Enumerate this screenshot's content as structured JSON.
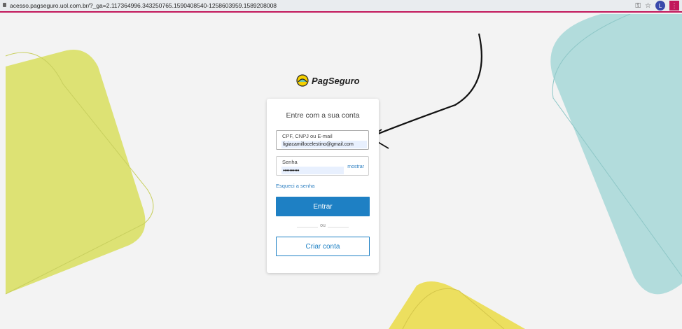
{
  "browser": {
    "url": "acesso.pagseguro.uol.com.br/?_ga=2.117364996.343250765.1590408540-1258603959.1589208008",
    "avatar_letter": "L"
  },
  "logo": {
    "text": "PagSeguro"
  },
  "login": {
    "title": "Entre com a sua conta",
    "email_label": "CPF, CNPJ ou E-mail",
    "email_value": "ligiacamillocelestino@gmail.com",
    "password_label": "Senha",
    "password_value": "••••••••••",
    "show_label": "mostrar",
    "forgot_label": "Esqueci a senha",
    "submit_label": "Entrar",
    "or_label": "ou",
    "create_label": "Criar conta"
  },
  "colors": {
    "accent": "#1e80c4",
    "yellow_green": "#dde274",
    "teal": "#b2dcdc",
    "yellow": "#ecdf5f",
    "browser_accent": "#c2185b"
  }
}
